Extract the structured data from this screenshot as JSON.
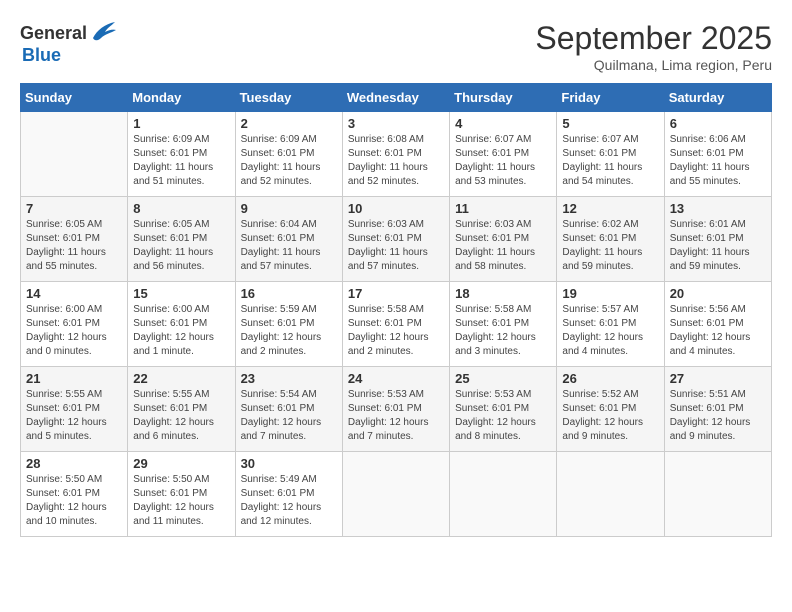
{
  "header": {
    "logo_general": "General",
    "logo_blue": "Blue",
    "title": "September 2025",
    "subtitle": "Quilmana, Lima region, Peru"
  },
  "days_of_week": [
    "Sunday",
    "Monday",
    "Tuesday",
    "Wednesday",
    "Thursday",
    "Friday",
    "Saturday"
  ],
  "weeks": [
    [
      {
        "day": "",
        "info": ""
      },
      {
        "day": "1",
        "info": "Sunrise: 6:09 AM\nSunset: 6:01 PM\nDaylight: 11 hours\nand 51 minutes."
      },
      {
        "day": "2",
        "info": "Sunrise: 6:09 AM\nSunset: 6:01 PM\nDaylight: 11 hours\nand 52 minutes."
      },
      {
        "day": "3",
        "info": "Sunrise: 6:08 AM\nSunset: 6:01 PM\nDaylight: 11 hours\nand 52 minutes."
      },
      {
        "day": "4",
        "info": "Sunrise: 6:07 AM\nSunset: 6:01 PM\nDaylight: 11 hours\nand 53 minutes."
      },
      {
        "day": "5",
        "info": "Sunrise: 6:07 AM\nSunset: 6:01 PM\nDaylight: 11 hours\nand 54 minutes."
      },
      {
        "day": "6",
        "info": "Sunrise: 6:06 AM\nSunset: 6:01 PM\nDaylight: 11 hours\nand 55 minutes."
      }
    ],
    [
      {
        "day": "7",
        "info": "Sunrise: 6:05 AM\nSunset: 6:01 PM\nDaylight: 11 hours\nand 55 minutes."
      },
      {
        "day": "8",
        "info": "Sunrise: 6:05 AM\nSunset: 6:01 PM\nDaylight: 11 hours\nand 56 minutes."
      },
      {
        "day": "9",
        "info": "Sunrise: 6:04 AM\nSunset: 6:01 PM\nDaylight: 11 hours\nand 57 minutes."
      },
      {
        "day": "10",
        "info": "Sunrise: 6:03 AM\nSunset: 6:01 PM\nDaylight: 11 hours\nand 57 minutes."
      },
      {
        "day": "11",
        "info": "Sunrise: 6:03 AM\nSunset: 6:01 PM\nDaylight: 11 hours\nand 58 minutes."
      },
      {
        "day": "12",
        "info": "Sunrise: 6:02 AM\nSunset: 6:01 PM\nDaylight: 11 hours\nand 59 minutes."
      },
      {
        "day": "13",
        "info": "Sunrise: 6:01 AM\nSunset: 6:01 PM\nDaylight: 11 hours\nand 59 minutes."
      }
    ],
    [
      {
        "day": "14",
        "info": "Sunrise: 6:00 AM\nSunset: 6:01 PM\nDaylight: 12 hours\nand 0 minutes."
      },
      {
        "day": "15",
        "info": "Sunrise: 6:00 AM\nSunset: 6:01 PM\nDaylight: 12 hours\nand 1 minute."
      },
      {
        "day": "16",
        "info": "Sunrise: 5:59 AM\nSunset: 6:01 PM\nDaylight: 12 hours\nand 2 minutes."
      },
      {
        "day": "17",
        "info": "Sunrise: 5:58 AM\nSunset: 6:01 PM\nDaylight: 12 hours\nand 2 minutes."
      },
      {
        "day": "18",
        "info": "Sunrise: 5:58 AM\nSunset: 6:01 PM\nDaylight: 12 hours\nand 3 minutes."
      },
      {
        "day": "19",
        "info": "Sunrise: 5:57 AM\nSunset: 6:01 PM\nDaylight: 12 hours\nand 4 minutes."
      },
      {
        "day": "20",
        "info": "Sunrise: 5:56 AM\nSunset: 6:01 PM\nDaylight: 12 hours\nand 4 minutes."
      }
    ],
    [
      {
        "day": "21",
        "info": "Sunrise: 5:55 AM\nSunset: 6:01 PM\nDaylight: 12 hours\nand 5 minutes."
      },
      {
        "day": "22",
        "info": "Sunrise: 5:55 AM\nSunset: 6:01 PM\nDaylight: 12 hours\nand 6 minutes."
      },
      {
        "day": "23",
        "info": "Sunrise: 5:54 AM\nSunset: 6:01 PM\nDaylight: 12 hours\nand 7 minutes."
      },
      {
        "day": "24",
        "info": "Sunrise: 5:53 AM\nSunset: 6:01 PM\nDaylight: 12 hours\nand 7 minutes."
      },
      {
        "day": "25",
        "info": "Sunrise: 5:53 AM\nSunset: 6:01 PM\nDaylight: 12 hours\nand 8 minutes."
      },
      {
        "day": "26",
        "info": "Sunrise: 5:52 AM\nSunset: 6:01 PM\nDaylight: 12 hours\nand 9 minutes."
      },
      {
        "day": "27",
        "info": "Sunrise: 5:51 AM\nSunset: 6:01 PM\nDaylight: 12 hours\nand 9 minutes."
      }
    ],
    [
      {
        "day": "28",
        "info": "Sunrise: 5:50 AM\nSunset: 6:01 PM\nDaylight: 12 hours\nand 10 minutes."
      },
      {
        "day": "29",
        "info": "Sunrise: 5:50 AM\nSunset: 6:01 PM\nDaylight: 12 hours\nand 11 minutes."
      },
      {
        "day": "30",
        "info": "Sunrise: 5:49 AM\nSunset: 6:01 PM\nDaylight: 12 hours\nand 12 minutes."
      },
      {
        "day": "",
        "info": ""
      },
      {
        "day": "",
        "info": ""
      },
      {
        "day": "",
        "info": ""
      },
      {
        "day": "",
        "info": ""
      }
    ]
  ]
}
